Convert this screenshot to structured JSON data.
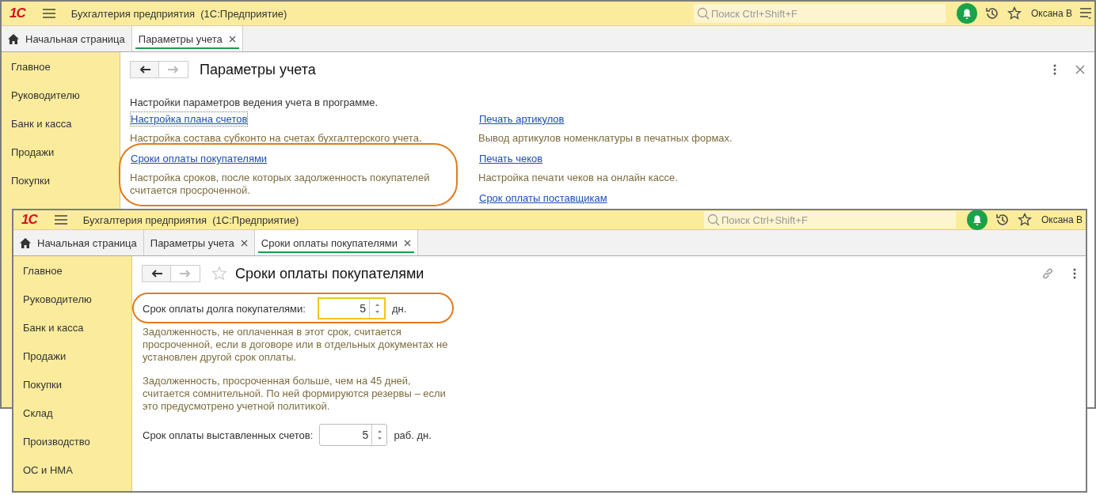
{
  "windows": [
    {
      "logo": "1С",
      "app_title": "Бухгалтерия предприятия  (1С:Предприятие)",
      "search": {
        "placeholder": "Поиск Ctrl+Shift+F"
      },
      "user": "Оксана В",
      "menu_button": true,
      "tabs": [
        {
          "label": "Начальная страница",
          "kind": "home",
          "selected": false
        },
        {
          "label": "Параметры учета",
          "kind": "tab",
          "selected": true
        }
      ],
      "sidebar": {
        "items": [
          "Главное",
          "Руководителю",
          "Банк и касса",
          "Продажи",
          "Покупки"
        ]
      },
      "page": {
        "kind": "links",
        "title": "Параметры учета",
        "header_icons": [
          {
            "kind": "more"
          },
          {
            "kind": "close"
          }
        ],
        "intro": "Настройки параметров ведения учета в программе.",
        "columns": [
          [
            {
              "link": "Настройка плана счетов",
              "description": "Настройка состава субконто на счетах бухгалтерского учета.",
              "focused": true
            },
            {
              "link": "Сроки оплаты покупателями",
              "description": "Настройка сроков, после которых задолженность покупателей считается просроченной.",
              "highlighted": true,
              "focused": false
            }
          ],
          [
            {
              "link": "Печать артикулов",
              "description": "Вывод артикулов номенклатуры в печатных формах.",
              "focused": false
            },
            {
              "link": "Печать чеков",
              "description": "Настройка печати чеков на онлайн кассе.",
              "focused": false
            },
            {
              "link": "Срок оплаты поставщикам",
              "focused": false
            }
          ]
        ]
      }
    },
    {
      "logo": "1С",
      "app_title": "Бухгалтерия предприятия  (1С:Предприятие)",
      "search": {
        "placeholder": "Поиск Ctrl+Shift+F"
      },
      "user": "Оксана В",
      "tabs": [
        {
          "label": "Начальная страница",
          "kind": "home",
          "selected": false
        },
        {
          "label": "Параметры учета",
          "kind": "tab",
          "selected": false
        },
        {
          "label": "Сроки оплаты покупателями",
          "kind": "tab",
          "selected": true
        }
      ],
      "sidebar": {
        "items": [
          "Главное",
          "Руководителю",
          "Банк и касса",
          "Продажи",
          "Покупки",
          "Склад",
          "Производство",
          "ОС и НМА"
        ]
      },
      "page": {
        "kind": "form",
        "title": "Сроки оплаты покупателями",
        "favorite_star": true,
        "header_icons": [
          {
            "kind": "link"
          },
          {
            "kind": "more"
          }
        ],
        "fields": [
          {
            "label": "Срок оплаты долга покупателями:",
            "value": "5",
            "unit": "дн.",
            "focused": true,
            "highlighted": true,
            "notes": [
              "Задолженность, не оплаченная в этот срок, считается просроченной, если в договоре или в отдельных документах не установлен другой срок оплаты.",
              "Задолженность, просроченная больше, чем на 45 дней, считается сомнительной. По ней формируются резервы – если это предусмотрено учетной политикой."
            ]
          },
          {
            "label": "Срок оплаты выставленных счетов:",
            "value": "5",
            "unit": "раб. дн.",
            "focused": false
          }
        ]
      }
    }
  ]
}
